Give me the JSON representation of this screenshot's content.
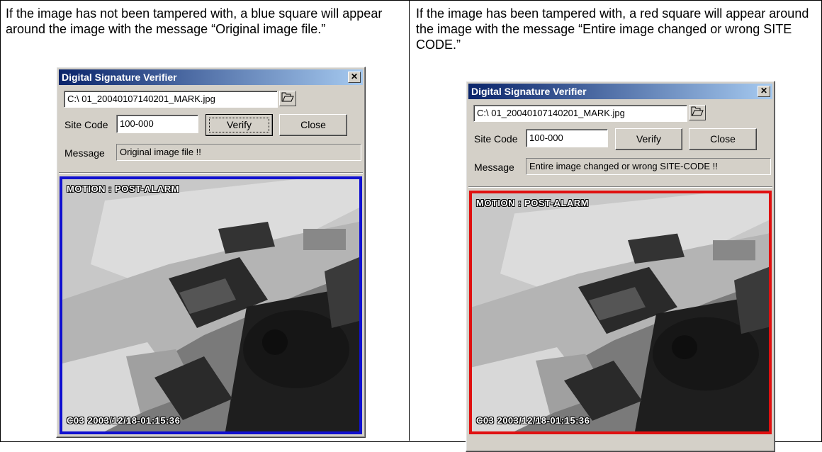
{
  "left": {
    "caption": "If the image has not been tampered with, a blue square will appear around the image with the message “Original image file.”",
    "frame_color": "#1010d0"
  },
  "right": {
    "caption": "If the image has been tampered with, a red square will appear around the image with the message “Entire image changed or wrong SITE CODE.”",
    "frame_color": "#e01010"
  },
  "dialog": {
    "title": "Digital Signature Verifier",
    "close_glyph": "✕",
    "file_path": "C:\\ 01_20040107140201_MARK.jpg",
    "browse_icon": "open-folder-icon",
    "site_code_label": "Site Code",
    "site_code_value": "100-000",
    "verify_label": "Verify",
    "close_label": "Close",
    "message_label": "Message"
  },
  "left_dialog": {
    "message": "Original image file !!"
  },
  "right_dialog": {
    "message": "Entire image changed or wrong SITE-CODE !!"
  },
  "cctv": {
    "top_overlay": "MOTION : POST-ALARM",
    "bottom_overlay": "C03 2003/12/18-01:15:36"
  }
}
